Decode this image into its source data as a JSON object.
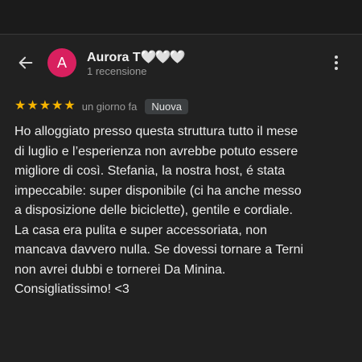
{
  "review": {
    "author_name_prefix": "Aurora T",
    "author_name_hearts": "🤍🤍🤍",
    "author_subtitle": "1 recensione",
    "avatar_letter": "A",
    "rating": 5,
    "stars": [
      "★",
      "★",
      "★",
      "★",
      "★"
    ],
    "time_ago": "un giorno fa",
    "badge": "Nuova",
    "text_lines": [
      "Ho alloggiato presso questa struttura tutto il mese",
      "di luglio e l’esperienza non avrebbe potuto essere",
      "migliore di così. Stefania, la nostra host, é stata",
      "impeccabile: super disponibile (ci ha anche messo",
      "a disposizione delle biciclette), gentile e cordiale.",
      "La casa era pulita e super accessoriata, non",
      "mancava davvero nulla. Se dovessi tornare a Terni",
      "non avrei dubbi e tornerei Da Minina.",
      "Consigliatissimo! <3"
    ]
  },
  "icons": {
    "back": "arrow-left-icon",
    "more": "more-vertical-icon",
    "star": "star-icon"
  },
  "colors": {
    "background": "#212121",
    "avatar": "#d8205f",
    "star": "#f6b400",
    "badge_bg": "#3c3f41"
  }
}
